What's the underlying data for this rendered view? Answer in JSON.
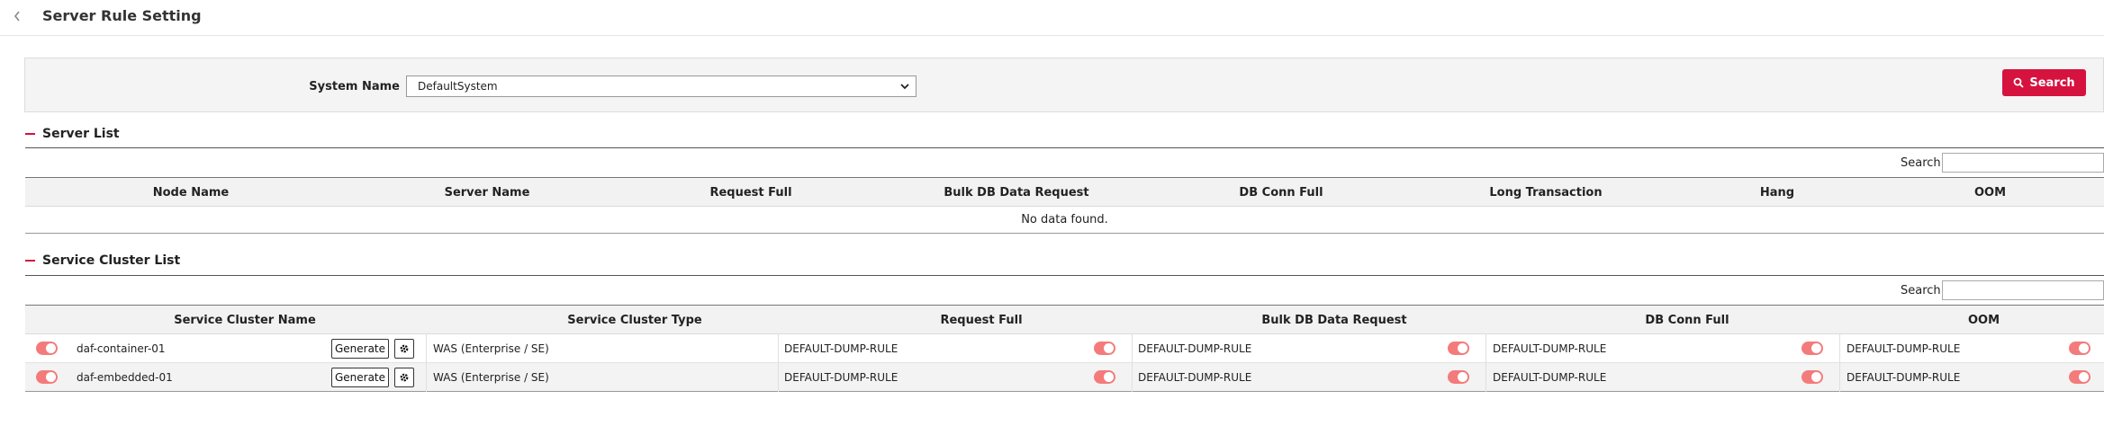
{
  "header": {
    "title": "Server Rule Setting",
    "back_icon": "chevron-left-icon"
  },
  "search_panel": {
    "system_label": "System Name",
    "system_value": "DefaultSystem",
    "search_button": "Search",
    "accent_color": "#d6123f"
  },
  "server_list": {
    "title": "Server List",
    "search_label": "Search",
    "columns": [
      "Node Name",
      "Server Name",
      "Request Full",
      "Bulk DB Data Request",
      "DB Conn Full",
      "Long Transaction",
      "Hang",
      "OOM"
    ],
    "empty_text": "No data found."
  },
  "service_cluster_list": {
    "title": "Service Cluster List",
    "search_label": "Search",
    "columns": [
      "Service Cluster Name",
      "Service Cluster Type",
      "Request Full",
      "Bulk DB Data Request",
      "DB Conn Full",
      "OOM"
    ],
    "generate_label": "Generate",
    "rows": [
      {
        "enabled": true,
        "name": "daf-container-01",
        "type": "WAS (Enterprise / SE)",
        "request_full": "DEFAULT-DUMP-RULE",
        "bulk_db": "DEFAULT-DUMP-RULE",
        "db_conn": "DEFAULT-DUMP-RULE",
        "oom": "DEFAULT-DUMP-RULE"
      },
      {
        "enabled": true,
        "name": "daf-embedded-01",
        "type": "WAS (Enterprise / SE)",
        "request_full": "DEFAULT-DUMP-RULE",
        "bulk_db": "DEFAULT-DUMP-RULE",
        "db_conn": "DEFAULT-DUMP-RULE",
        "oom": "DEFAULT-DUMP-RULE"
      }
    ],
    "toggle_color": "#f47b7b"
  }
}
